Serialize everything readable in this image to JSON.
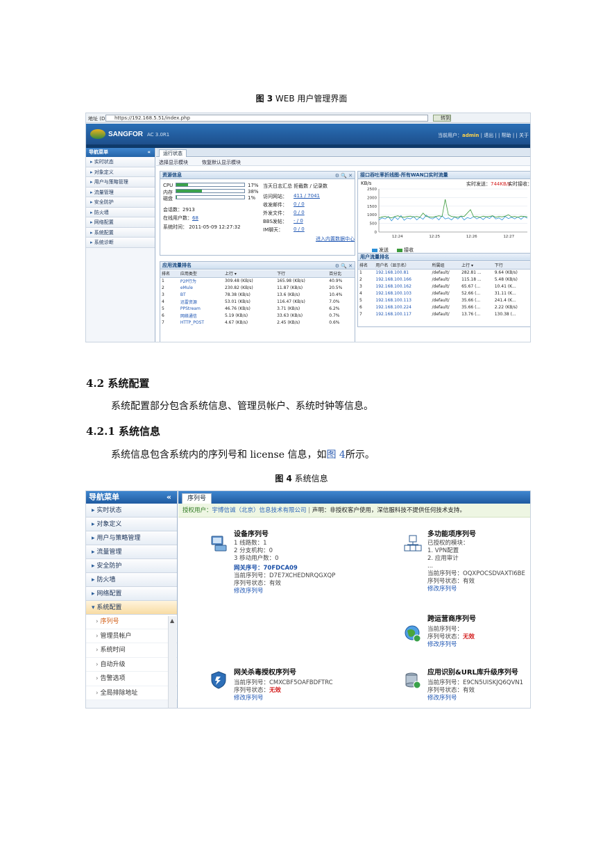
{
  "fig3": {
    "num": "图 3",
    "text": "WEB 用户管理界面"
  },
  "shot1": {
    "address_label": "地址 (D)",
    "url": "https://192.168.5.51/index.php",
    "go_label": "转到",
    "brand": "SANGFOR",
    "version": "AC 3.0R1",
    "user_prefix": "当前用户：",
    "username": "admin",
    "user_links": "| 退出 | | 帮助 | | 关于",
    "nav_title": "导航菜单",
    "nav_collapse": "«",
    "nav_items": [
      "实时状态",
      "对象定义",
      "用户与策略管理",
      "流量管理",
      "安全防护",
      "防火墙",
      "网络配置",
      "系统配置",
      "系统诊断"
    ],
    "tab": "运行状态",
    "tool_show": "选择显示模块",
    "tool_reset": "恢复默认显示模块",
    "res": {
      "title": "资源信息",
      "buttons": "⚙ 🔍 ✕",
      "cpu_label": "CPU",
      "cpu_pct": "17%",
      "cpu": 0.17,
      "mem_label": "内存",
      "mem_pct": "38%",
      "mem": 0.38,
      "disk_label": "磁盘",
      "disk_pct": "1%",
      "disk": 0.01,
      "sessions": "会话数：2913",
      "online": "在线用户数：",
      "online_val": "68",
      "systime": "系统时间： 2011-05-09 12:27:32",
      "log_title": "当天日志汇总  拒截数 / 记录数",
      "log_rows": [
        {
          "k": "访问网站：",
          "v": "411 / 7041"
        },
        {
          "k": "收发邮件：",
          "v": "0 / 0"
        },
        {
          "k": "外发文件：",
          "v": "0 / 0"
        },
        {
          "k": "BBS发帖：",
          "v": "- / 0"
        },
        {
          "k": "IM聊天：",
          "v": "0 / 0"
        }
      ],
      "datacenter": "进入内置数据中心"
    },
    "chart": {
      "title": "接口吞吐率折线图-所有WAN口实时流量",
      "realtime_out_label": "实时发送：",
      "realtime_out": "744KB/s",
      "realtime_in_label": "实时接收：",
      "legend": [
        "发送",
        "接收"
      ]
    },
    "chart_data": {
      "type": "line",
      "ylabel": "KB/s",
      "yticks": [
        "2500",
        "2000",
        "1500",
        "1000",
        "500",
        "0"
      ],
      "xticks": [
        "12:24",
        "12:25",
        "12:26",
        "12:27"
      ],
      "ylim": [
        0,
        2500
      ],
      "series": [
        {
          "name": "发送",
          "color": "#2b8fd8",
          "values": [
            700,
            820,
            760,
            900,
            650,
            880,
            720,
            950,
            680,
            820,
            760,
            900,
            700,
            860,
            740,
            980,
            820,
            760,
            880,
            700,
            940,
            760,
            820,
            700,
            880,
            760,
            920,
            700,
            840,
            780,
            900,
            760,
            860,
            720,
            880,
            780,
            940,
            760,
            820,
            700,
            900,
            780,
            860,
            760,
            880,
            740,
            900,
            800
          ]
        },
        {
          "name": "接收",
          "color": "#3a9a3a",
          "values": [
            820,
            880,
            900,
            860,
            820,
            900,
            940,
            880,
            860,
            900,
            920,
            870,
            900,
            860,
            1100,
            900,
            880,
            860,
            900,
            940,
            900,
            1900,
            1000,
            900,
            880,
            860,
            920,
            900,
            1100,
            1300,
            880,
            900,
            860,
            920,
            880,
            900,
            940,
            860,
            900,
            880,
            920,
            1000,
            880,
            900,
            860,
            920,
            900,
            880
          ]
        }
      ]
    },
    "app": {
      "title": "应用流量排名",
      "headers": [
        "排名",
        "应用类型",
        "上行 ▾",
        "下行",
        "百分比"
      ],
      "rows": [
        [
          "1",
          "P2P行为",
          "309.48 (KB/s)",
          "165.98 (KB/s)",
          "40.9%"
        ],
        [
          "2",
          "eMule",
          "230.82 (KB/s)",
          "11.87 (KB/s)",
          "20.5%"
        ],
        [
          "3",
          "BT",
          "78.38 (KB/s)",
          "13.6 (KB/s)",
          "10.4%"
        ],
        [
          "4",
          "迅雷资源",
          "53.01 (KB/s)",
          "116.47 (KB/s)",
          "7.0%"
        ],
        [
          "5",
          "PPStream",
          "46.76 (KB/s)",
          "3.71 (KB/s)",
          "6.2%"
        ],
        [
          "6",
          "网络通信",
          "5.19 (KB/s)",
          "33.63 (KB/s)",
          "0.7%"
        ],
        [
          "7",
          "HTTP_POST",
          "4.67 (KB/s)",
          "2.45 (KB/s)",
          "0.6%"
        ]
      ]
    },
    "users": {
      "title": "用户流量排名",
      "headers": [
        "排名",
        "用户名（显示名）",
        "所属组",
        "上行 ▾",
        "下行"
      ],
      "rows": [
        [
          "1",
          "192.168.100.81",
          "/default/",
          "282.81 ...",
          "9.64 (KB/s)"
        ],
        [
          "2",
          "192.168.100.166",
          "/default/",
          "115.18 ...",
          "5.48 (KB/s)"
        ],
        [
          "3",
          "192.168.100.162",
          "/default/",
          "65.67 (...",
          "10.41 (K..."
        ],
        [
          "4",
          "192.168.100.103",
          "/default/",
          "52.66 (...",
          "31.11 (K..."
        ],
        [
          "5",
          "192.168.100.113",
          "/default/",
          "35.66 (...",
          "241.4 (K..."
        ],
        [
          "6",
          "192.168.100.224",
          "/default/",
          "35.66 (...",
          "2.22 (KB/s)"
        ],
        [
          "7",
          "192.168.100.117",
          "/default/",
          "13.76 (...",
          "130.38 (..."
        ]
      ]
    }
  },
  "section_42": "4.2  系统配置",
  "para_42": "系统配置部分包含系统信息、管理员帐户、系统时钟等信息。",
  "section_421": "4.2.1  系统信息",
  "para_421_a": "系统信息包含系统内的序列号和 license 信息，如",
  "para_421_link": "图 4",
  "para_421_b": "所示。",
  "fig4": {
    "num": "图 4",
    "text": "系统信息"
  },
  "shot2": {
    "nav_title": "导航菜单",
    "nav_collapse": "«",
    "nav_items": [
      "实时状态",
      "对象定义",
      "用户与策略管理",
      "流量管理",
      "安全防护",
      "防火墙",
      "网络配置"
    ],
    "open_item": "系统配置",
    "sub_items": [
      "序列号",
      "管理员帐户",
      "系统时间",
      "自动升级",
      "告警选项",
      "全局排除地址"
    ],
    "tab": "序列号",
    "notice_k": "授权用户：",
    "notice_v": "宇博信诚（北京）信息技术有限公司",
    "notice_sep": "|",
    "notice_decl": "声明：非授权客户使用，深信服科技不提供任何技术支持。",
    "device": {
      "title": "设备序列号",
      "lines": [
        "1 线路数：1",
        "2 分支机构：0",
        "3 移动用户数：0"
      ],
      "gw_label": "网关序号：",
      "gw": "70FDCA09",
      "cur": "当前序列号：D7E7XCHEDNRQGXQP",
      "status": "序列号状态：有效",
      "modify": "修改序列号"
    },
    "multi": {
      "title": "多功能项序列号",
      "lines": [
        "已授权的模块：",
        "1. VPN配置",
        "2. 应用审计",
        "..."
      ],
      "cur": "当前序列号：OQXPOCSDVAXTI6BE",
      "status": "序列号状态：有效",
      "modify": "修改序列号"
    },
    "isp": {
      "title": "跨运营商序列号",
      "cur": "当前序列号：",
      "status_label": "序列号状态：",
      "status": "无效",
      "modify": "修改序列号"
    },
    "av": {
      "title": "网关杀毒授权序列号",
      "cur": "当前序列号：CMXCBF5OAFBDFTRC",
      "status_label": "序列号状态：",
      "status": "无效",
      "modify": "修改序列号"
    },
    "app": {
      "title": "应用识别&URL库升级序列号",
      "cur": "当前序列号：E9CN5UISKJQ6QVN1",
      "status": "序列号状态：有效",
      "modify": "修改序列号"
    }
  }
}
